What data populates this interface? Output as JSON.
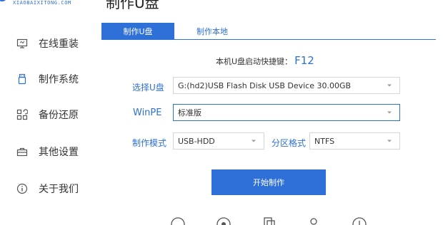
{
  "header": {
    "logo_text": "XIAOBAIXITONG.COM",
    "title": "制作U盘"
  },
  "sidebar": {
    "items": [
      {
        "label": "在线重装",
        "icon": "monitor-icon"
      },
      {
        "label": "制作系统",
        "icon": "usb-drive-icon"
      },
      {
        "label": "备份还原",
        "icon": "backup-grid-icon"
      },
      {
        "label": "其他设置",
        "icon": "toolbox-icon"
      },
      {
        "label": "关于我们",
        "icon": "info-icon"
      }
    ]
  },
  "tabs": [
    {
      "label": "制作U盘",
      "active": true
    },
    {
      "label": "制作本地",
      "active": false
    }
  ],
  "hotkey": {
    "label": "本机U盘启动快捷键：",
    "key": "F12"
  },
  "form": {
    "usb_label": "选择U盘",
    "usb_value": "G:(hd2)USB Flash Disk USB Device 30.00GB",
    "winpe_label": "WinPE",
    "winpe_value": "标准版",
    "mode_label": "制作模式",
    "mode_value": "USB-HDD",
    "partition_label": "分区格式",
    "partition_value": "NTFS"
  },
  "start_button": "开始制作",
  "colors": {
    "accent": "#2e6fd8",
    "text": "#333333",
    "border": "#d6d6d6"
  }
}
